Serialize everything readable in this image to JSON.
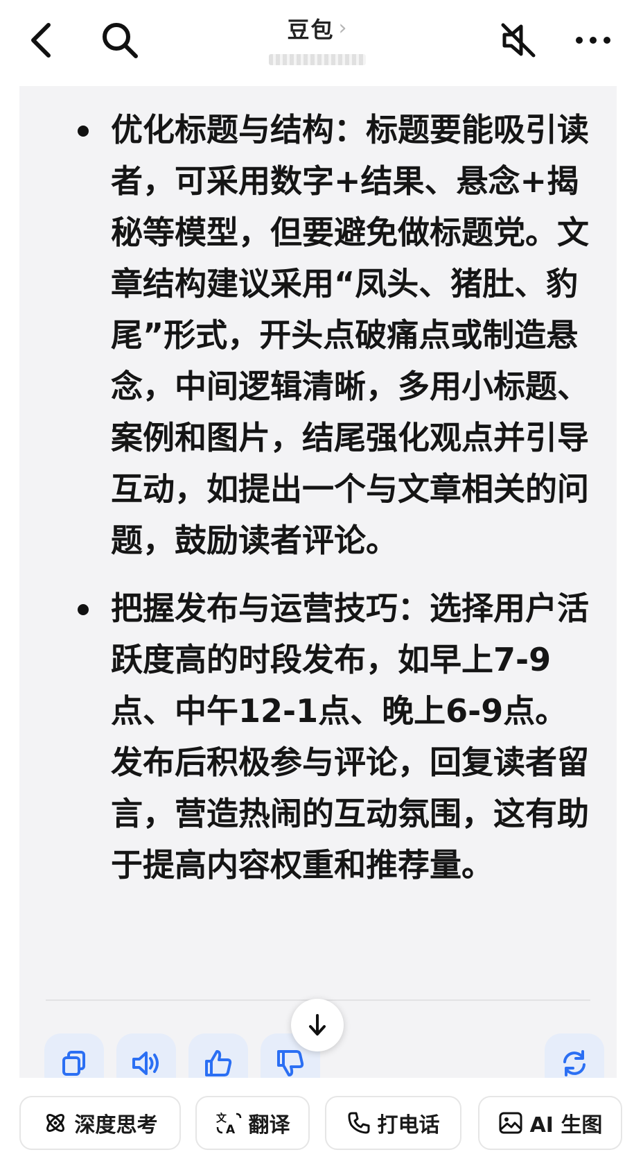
{
  "header": {
    "title": "豆包",
    "title_chevron": "›",
    "icons": {
      "back": "chevron-left-icon",
      "search": "search-icon",
      "mute": "speaker-muted-icon",
      "more": "more-icon"
    }
  },
  "message": {
    "items": [
      {
        "key": "优化标题与结构",
        "separator": "：",
        "text": "标题要能吸引读者，可采用数字+结果、悬念+揭秘等模型，但要避免做标题党。文章结构建议采用“凤头、猪肚、豹尾”形式，开头点破痛点或制造悬念，中间逻辑清晰，多用小标题、案例和图片，结尾强化观点并引导互动，如提出一个与文章相关的问题，鼓励读者评论。"
      },
      {
        "key": "把握发布与运营技巧",
        "separator": "：",
        "text": "选择用户活跃度高的时段发布，如早上7-9点、中午12-1点、晚上6-9点。发布后积极参与评论，回复读者留言，营造热闹的互动氛围，这有助于提高内容权重和推荐量。"
      }
    ],
    "actions": [
      "copy-icon",
      "speaker-icon",
      "thumbs-up-icon",
      "thumbs-down-icon",
      "refresh-icon"
    ]
  },
  "quick_actions": [
    {
      "label": "深度思考",
      "icon": "atom-icon"
    },
    {
      "label": "翻译",
      "icon": "translate-icon"
    },
    {
      "label": "打电话",
      "icon": "phone-icon"
    },
    {
      "label": "AI 生图",
      "icon": "image-icon"
    }
  ],
  "colors": {
    "card_background": "#f3f3f5",
    "action_button_bg": "#e6edfa",
    "accent_blue": "#2b6ff3",
    "text": "#151515"
  }
}
